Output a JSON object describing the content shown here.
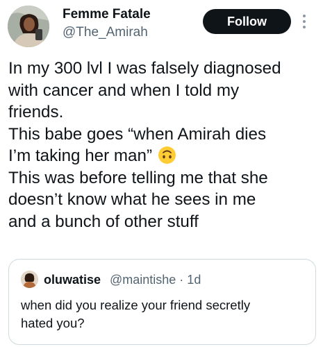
{
  "author": {
    "display_name": "Femme Fatale",
    "handle": "@The_Amirah"
  },
  "follow_label": "Follow",
  "tweet": {
    "lines": [
      "In my 300 lvl I was falsely diagnosed",
      "with cancer and when I told my",
      "friends.",
      "This babe goes “when Amirah dies",
      "I’m taking her man”",
      "This was before telling me that she",
      "doesn’t know what he sees in me",
      "and a bunch of other stuff"
    ],
    "emoji": "upside-down-face-emoji"
  },
  "quoted": {
    "display_name": "oluwatise",
    "meta": "@maintishe · 1d",
    "lines": [
      "when did you realize your friend secretly",
      "hated you?"
    ]
  },
  "icons": {
    "more": "more-vertical-icon"
  },
  "colors": {
    "text": "#0f1419",
    "secondary": "#536471",
    "button": "#0f1419",
    "border": "#cfd9de",
    "emoji": "#ffcc33"
  }
}
